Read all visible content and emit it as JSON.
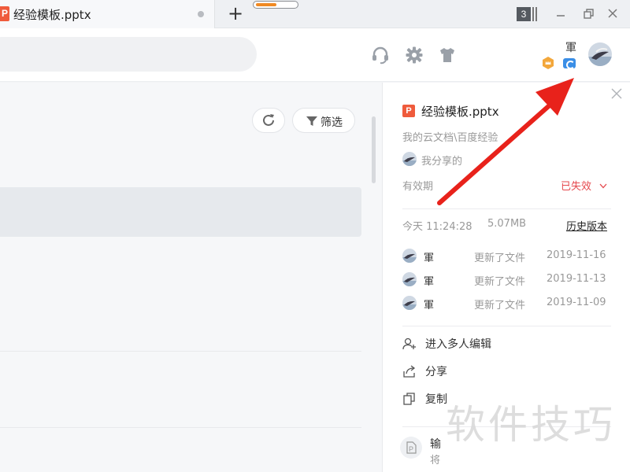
{
  "tab": {
    "icon_letter": "P",
    "title": "经验模板.pptx"
  },
  "window": {
    "tab_count": "3"
  },
  "user": {
    "name": "軍"
  },
  "main": {
    "filter_label": "筛选"
  },
  "panel": {
    "file_icon_letter": "P",
    "file_name": "经验模板.pptx",
    "path": "我的云文档\\百度经验",
    "share_text": "我分享的",
    "validity_label": "有效期",
    "validity_value": "已失效",
    "modified_time": "今天 11:24:28",
    "file_size": "5.07MB",
    "history_link": "历史版本",
    "activity": [
      {
        "user": "軍",
        "action": "更新了文件",
        "date": "2019-11-16"
      },
      {
        "user": "軍",
        "action": "更新了文件",
        "date": "2019-11-13"
      },
      {
        "user": "軍",
        "action": "更新了文件",
        "date": "2019-11-09"
      }
    ],
    "menu": [
      {
        "label": "进入多人编辑",
        "icon": "add-user-icon"
      },
      {
        "label": "分享",
        "icon": "share-icon"
      },
      {
        "label": "复制",
        "icon": "copy-icon"
      }
    ],
    "export_title": "输",
    "export_sub": "将"
  },
  "watermark": {
    "text": "软件技巧"
  },
  "colors": {
    "accent_red": "#e5484d",
    "brand_orange": "#ef5b3c",
    "annotation_arrow": "#e8221b"
  }
}
